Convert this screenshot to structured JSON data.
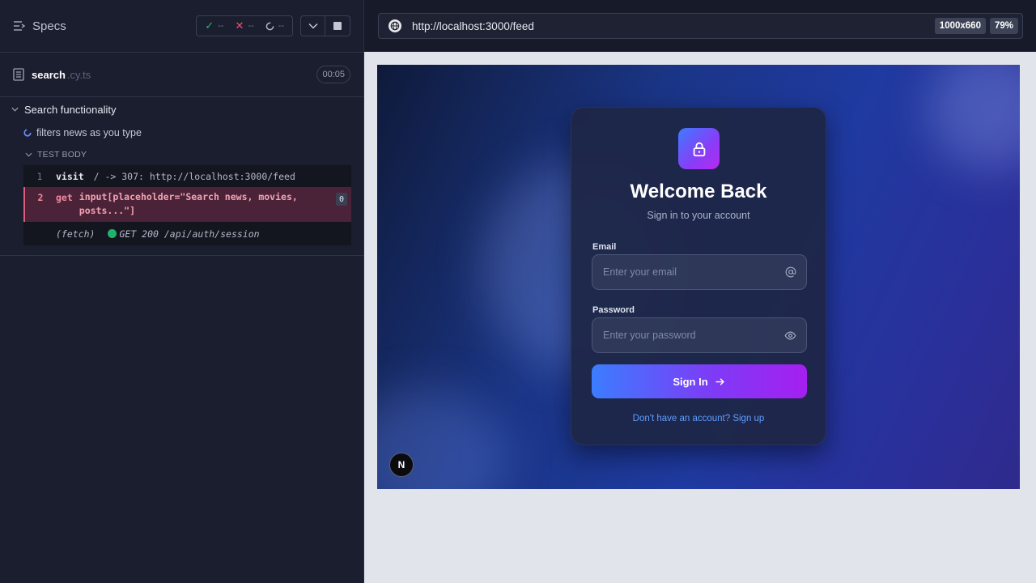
{
  "reporter": {
    "header": {
      "specs_label": "Specs",
      "passed": "--",
      "failed": "--",
      "pending": "--"
    },
    "spec": {
      "name": "search",
      "ext": ".cy.ts",
      "duration": "00:05"
    },
    "suite_title": "Search functionality",
    "test_title": "filters news as you type",
    "test_body_label": "TEST BODY",
    "commands": [
      {
        "num": "1",
        "name": "visit",
        "message": "/ -> 307: http://localhost:3000/feed"
      },
      {
        "num": "2",
        "name": "get",
        "message": "input[placeholder=\"Search news, movies, posts...\"]",
        "badge": "0"
      },
      {
        "prefix": "(fetch)",
        "message": "GET 200 /api/auth/session",
        "status_color": "#21b36b"
      }
    ]
  },
  "aut": {
    "url": "http://localhost:3000/feed",
    "viewport_size": "1000x660",
    "zoom": "79%",
    "login": {
      "title": "Welcome Back",
      "subtitle": "Sign in to your account",
      "email_label": "Email",
      "email_placeholder": "Enter your email",
      "password_label": "Password",
      "password_placeholder": "Enter your password",
      "submit_label": "Sign In",
      "signup_link": "Don't have an account? Sign up"
    },
    "dev_badge": "N"
  },
  "colors": {
    "accent_start": "#3b7dff",
    "accent_end": "#a51ff0",
    "fail": "#e05d7e",
    "pass": "#2fb36c"
  }
}
